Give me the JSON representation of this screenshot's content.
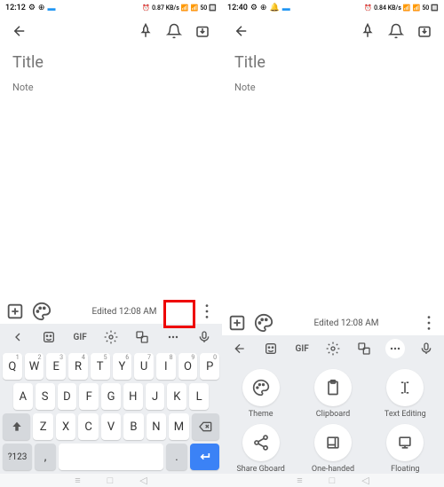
{
  "left": {
    "status": {
      "time": "12:12",
      "net": "0.87 KB/s",
      "bat": "50"
    },
    "title_ph": "Title",
    "note_ph": "Note",
    "timestamp": "Edited 12:08 AM",
    "keys": {
      "r1": [
        "Q",
        "W",
        "E",
        "R",
        "T",
        "Y",
        "U",
        "I",
        "O",
        "P"
      ],
      "nums": [
        "1",
        "2",
        "3",
        "4",
        "5",
        "6",
        "7",
        "8",
        "9",
        "0"
      ],
      "r2": [
        "A",
        "S",
        "D",
        "F",
        "G",
        "H",
        "J",
        "K",
        "L"
      ],
      "r3": [
        "Z",
        "X",
        "C",
        "V",
        "B",
        "N",
        "M"
      ],
      "mode": "?123",
      "comma": ",",
      "period": "."
    },
    "toprow": {
      "gif": "GIF"
    }
  },
  "right": {
    "status": {
      "time": "12:40",
      "net": "0.84 KB/s",
      "bat": "50"
    },
    "title_ph": "Title",
    "note_ph": "Note",
    "timestamp": "Edited 12:08 AM",
    "toprow": {
      "gif": "GIF"
    },
    "panel": {
      "theme": "Theme",
      "clipboard": "Clipboard",
      "textedit": "Text Editing",
      "share": "Share Gboard",
      "onehand": "One-handed",
      "floating": "Floating"
    }
  }
}
